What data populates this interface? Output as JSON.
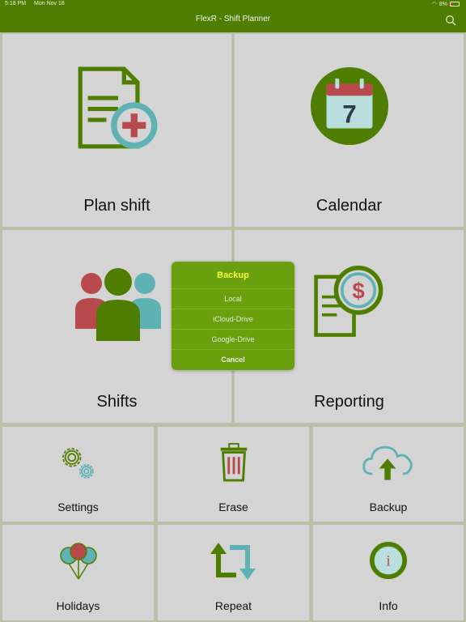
{
  "status": {
    "time": "5:18 PM",
    "date": "Mon Nov 18",
    "battery": "8%"
  },
  "header": {
    "title": "FlexR - Shift Planner"
  },
  "tiles": {
    "plan_shift": "Plan shift",
    "calendar": "Calendar",
    "calendar_day": "7",
    "shifts": "Shifts",
    "reporting": "Reporting",
    "settings": "Settings",
    "erase": "Erase",
    "backup": "Backup",
    "holidays": "Holidays",
    "repeat": "Repeat",
    "info": "Info",
    "info_glyph": "i",
    "reporting_glyph": "$"
  },
  "dialog": {
    "title": "Backup",
    "options": [
      "Local",
      "iCloud-Drive",
      "Google-Drive"
    ],
    "cancel": "Cancel"
  },
  "colors": {
    "primary": "#4f7d00",
    "accent_red": "#b84a4e",
    "accent_teal": "#5fb2b4",
    "tile_bg": "#d4d4d4",
    "dialog_bg": "#6aa00e",
    "dialog_title": "#f4ff3c"
  },
  "icons": {
    "search": "search-icon",
    "plan": "document-plus-icon",
    "calendar": "calendar-icon",
    "shifts": "people-icon",
    "reporting": "document-dollar-icon",
    "settings": "gears-icon",
    "erase": "trash-icon",
    "backup": "cloud-upload-icon",
    "holidays": "balloons-icon",
    "repeat": "repeat-icon",
    "info": "info-icon"
  }
}
